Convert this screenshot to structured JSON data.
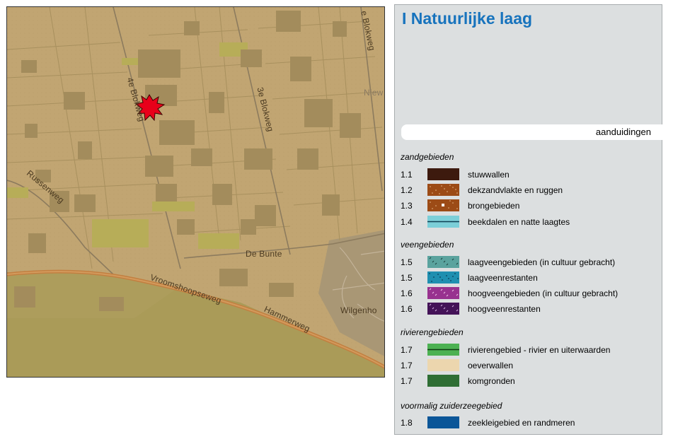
{
  "map": {
    "labels": {
      "blokweg4": "4e Blokweg",
      "blokweg3": "3e Blokweg",
      "blokweg_top": "e Blokweg",
      "russenweg": "Russenweg",
      "bunte": "De Bunte",
      "vroomshoop": "Vroomshoopseweg",
      "hammerweg": "Hammerweg",
      "wilgenho": "Wilgenho",
      "niew": "Niew"
    },
    "colors": {
      "base": "#c1a572",
      "field": "#b9a06a",
      "building": "#a08a5a",
      "greenland": "#b8ae5a",
      "road_main": "#c98a4a",
      "road_line": "#9e8a66",
      "lower_zone": "#a99a55",
      "marker": "#e8001a"
    },
    "marker_icon": "red-star-marker-icon"
  },
  "legend": {
    "title": "I Natuurlijke laag",
    "tab_label": "aanduidingen",
    "sections": [
      {
        "title": "zandgebieden",
        "items": [
          {
            "code": "1.1",
            "label": "stuwwallen",
            "swatch": "stuwwallen"
          },
          {
            "code": "1.2",
            "label": "dekzandvlakte en ruggen",
            "swatch": "dekzand"
          },
          {
            "code": "1.3",
            "label": "brongebieden",
            "swatch": "brong"
          },
          {
            "code": "1.4",
            "label": "beekdalen en natte laagtes",
            "swatch": "beekdal"
          }
        ]
      },
      {
        "title": "veengebieden",
        "items": [
          {
            "code": "1.5",
            "label": "laagveengebieden (in cultuur gebracht)",
            "swatch": "laagveen"
          },
          {
            "code": "1.5",
            "label": "laagveenrestanten",
            "swatch": "laagveenrest"
          },
          {
            "code": "1.6",
            "label": "hoogveengebieden (in cultuur gebracht)",
            "swatch": "hoogveen"
          },
          {
            "code": "1.6",
            "label": "hoogveenrestanten",
            "swatch": "hoogveenrest"
          }
        ]
      },
      {
        "title": "rivierengebieden",
        "items": [
          {
            "code": "1.7",
            "label": "rivierengebied - rivier en uiterwaarden",
            "swatch": "rivier"
          },
          {
            "code": "1.7",
            "label": "oeverwallen",
            "swatch": "oever"
          },
          {
            "code": "1.7",
            "label": "komgronden",
            "swatch": "kom"
          }
        ]
      },
      {
        "title": "voormalig zuiderzeegebied",
        "items": [
          {
            "code": "1.8",
            "label": "zeekleigebied en randmeren",
            "swatch": "zeeklei"
          }
        ]
      }
    ],
    "swatch_colors": {
      "stuwwallen": "#3d1a0e",
      "dekzand": "#9c4b16",
      "brong": "#9c4b16",
      "beekdal": "#7ccfd8",
      "laagveen": "#5aa39e",
      "laagveenrest": "#1f8fb0",
      "hoogveen": "#98328f",
      "hoogveenrest": "#431257",
      "rivier": "#4cb152",
      "oever": "#ecd6ae",
      "kom": "#2f6e34",
      "zeeklei": "#0b5698"
    }
  }
}
